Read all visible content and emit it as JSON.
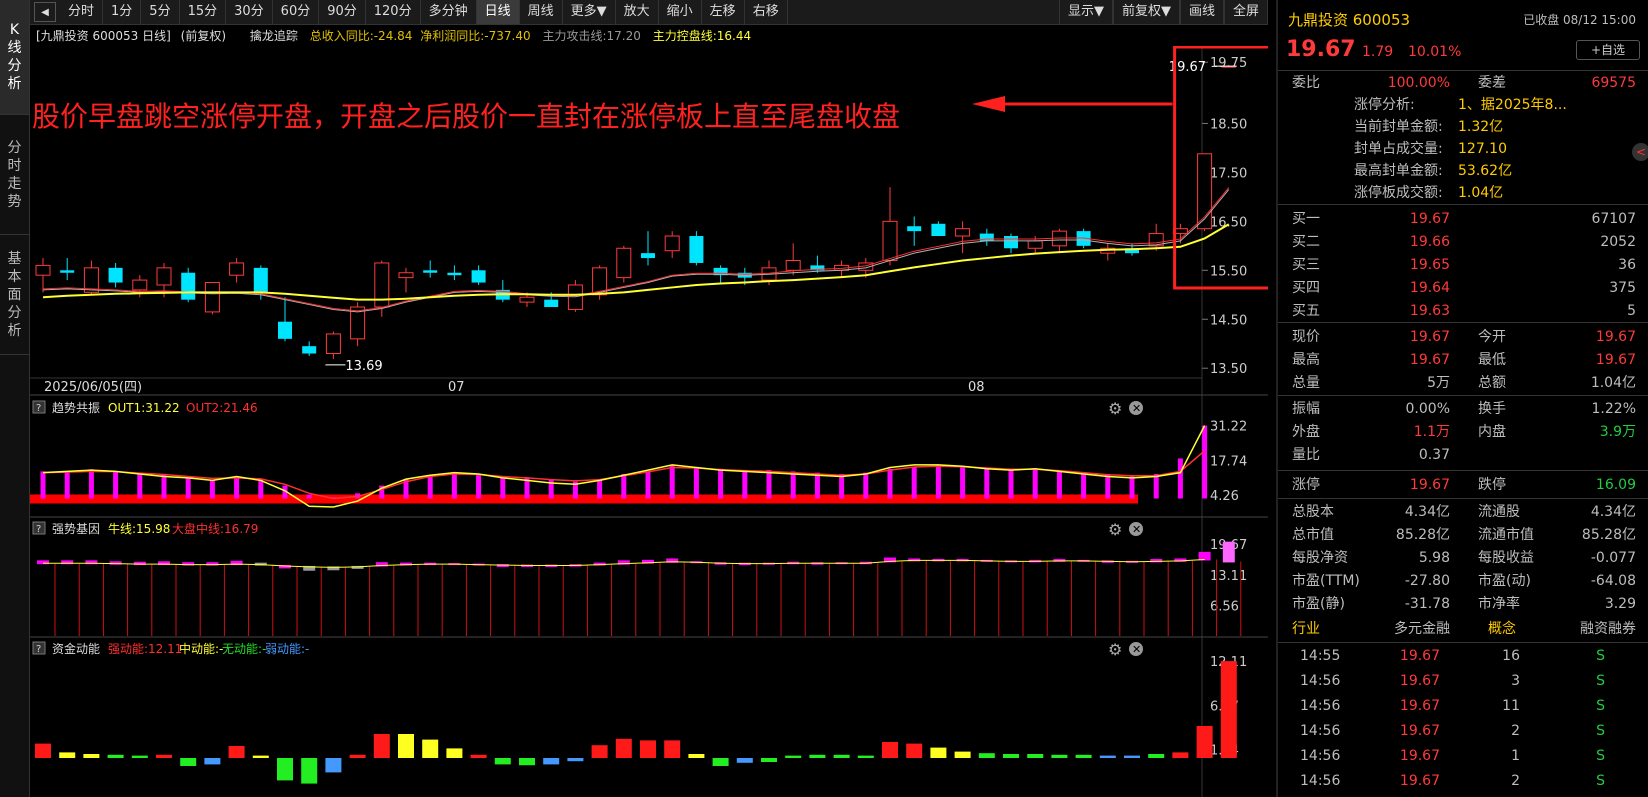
{
  "left_tabs": [
    "K线分析",
    "分时走势",
    "基本面分析"
  ],
  "toolbar": {
    "back_icon": "back-icon",
    "periods": [
      "分时",
      "1分",
      "5分",
      "15分",
      "30分",
      "60分",
      "90分",
      "120分",
      "多分钟",
      "日线",
      "周线",
      "更多▼"
    ],
    "active_period": "日线",
    "tools": [
      "放大",
      "缩小",
      "左移",
      "右移"
    ],
    "right": [
      "显示▼",
      "前复权▼",
      "画线",
      "全屏"
    ]
  },
  "chart_title": {
    "stock": "[九鼎投资 600053 日线]",
    "fq": "(前复权)",
    "indicator": "擒龙追踪",
    "revenue": "总收入同比:-24.84",
    "profit": "净利润同比:-737.40",
    "attack": "主力攻击线:17.20",
    "control": "主力控盘线:16.44"
  },
  "price_axis": [
    "19.75",
    "18.50",
    "17.50",
    "16.50",
    "15.50",
    "14.50",
    "13.50"
  ],
  "date_axis": [
    "2025/06/05(四)",
    "07",
    "08"
  ],
  "high_label": "19.67",
  "low_label": "13.69",
  "annotation": "股价早盘跳空涨停开盘，开盘之后股价一直封在涨停板上直至尾盘收盘",
  "chart_data": [
    {
      "type": "candlestick",
      "ylim": [
        13.3,
        20.0
      ],
      "ohlc": [
        [
          15.4,
          15.75,
          15.05,
          15.6
        ],
        [
          15.5,
          15.75,
          15.3,
          15.45
        ],
        [
          15.05,
          15.7,
          15.0,
          15.55
        ],
        [
          15.55,
          15.65,
          15.15,
          15.25
        ],
        [
          15.1,
          15.4,
          14.95,
          15.3
        ],
        [
          15.2,
          15.65,
          14.95,
          15.55
        ],
        [
          15.45,
          15.55,
          14.85,
          14.9
        ],
        [
          14.65,
          15.25,
          14.6,
          15.25
        ],
        [
          15.4,
          15.75,
          15.25,
          15.65
        ],
        [
          15.55,
          15.6,
          14.9,
          15.05
        ],
        [
          14.45,
          14.95,
          14.05,
          14.1
        ],
        [
          13.95,
          14.05,
          13.75,
          13.8
        ],
        [
          13.8,
          14.25,
          13.69,
          14.2
        ],
        [
          14.1,
          14.85,
          13.95,
          14.75
        ],
        [
          14.75,
          15.7,
          14.55,
          15.65
        ],
        [
          15.35,
          15.55,
          15.05,
          15.45
        ],
        [
          15.5,
          15.7,
          15.35,
          15.45
        ],
        [
          15.45,
          15.6,
          15.3,
          15.4
        ],
        [
          15.5,
          15.6,
          15.2,
          15.25
        ],
        [
          15.1,
          15.3,
          14.85,
          14.9
        ],
        [
          14.85,
          15.05,
          14.75,
          14.95
        ],
        [
          14.9,
          15.05,
          14.75,
          14.75
        ],
        [
          14.7,
          15.3,
          14.65,
          15.2
        ],
        [
          15.0,
          15.6,
          14.9,
          15.55
        ],
        [
          15.35,
          16.0,
          15.25,
          15.95
        ],
        [
          15.85,
          16.3,
          15.6,
          15.75
        ],
        [
          15.9,
          16.3,
          15.75,
          16.2
        ],
        [
          16.2,
          16.3,
          15.6,
          15.65
        ],
        [
          15.55,
          15.6,
          15.25,
          15.4
        ],
        [
          15.45,
          15.55,
          15.2,
          15.35
        ],
        [
          15.3,
          15.7,
          15.2,
          15.55
        ],
        [
          15.5,
          16.05,
          15.4,
          15.7
        ],
        [
          15.6,
          15.8,
          15.45,
          15.5
        ],
        [
          15.5,
          15.7,
          15.35,
          15.6
        ],
        [
          15.5,
          15.75,
          15.35,
          15.65
        ],
        [
          15.7,
          17.2,
          15.6,
          16.5
        ],
        [
          16.4,
          16.6,
          16.0,
          16.3
        ],
        [
          16.45,
          16.5,
          16.2,
          16.2
        ],
        [
          16.2,
          16.5,
          15.85,
          16.35
        ],
        [
          16.25,
          16.35,
          16.0,
          16.1
        ],
        [
          16.2,
          16.25,
          15.85,
          15.95
        ],
        [
          15.95,
          16.2,
          15.85,
          16.1
        ],
        [
          16.0,
          16.35,
          15.85,
          16.3
        ],
        [
          16.3,
          16.35,
          15.95,
          16.0
        ],
        [
          15.85,
          16.05,
          15.7,
          15.95
        ],
        [
          15.95,
          16.05,
          15.8,
          15.85
        ],
        [
          16.0,
          16.45,
          15.9,
          16.25
        ],
        [
          16.25,
          16.45,
          16.05,
          16.35
        ],
        [
          16.35,
          17.88,
          16.3,
          17.88
        ],
        [
          19.67,
          19.67,
          19.67,
          19.67
        ]
      ],
      "ma_white": [
        15.1,
        15.12,
        15.1,
        15.08,
        15.05,
        15.06,
        15.04,
        15.02,
        15.03,
        15.0,
        14.9,
        14.8,
        14.7,
        14.65,
        14.72,
        14.85,
        14.95,
        15.05,
        15.07,
        15.05,
        15.0,
        14.97,
        14.96,
        15.05,
        15.15,
        15.25,
        15.38,
        15.42,
        15.42,
        15.4,
        15.42,
        15.45,
        15.48,
        15.5,
        15.55,
        15.7,
        15.85,
        15.95,
        16.05,
        16.1,
        16.1,
        16.1,
        16.12,
        16.12,
        16.05,
        16.0,
        16.02,
        16.1,
        16.55,
        17.15
      ],
      "ma_yellow": [
        14.95,
        14.98,
        15.0,
        15.02,
        15.03,
        15.04,
        15.05,
        15.05,
        15.05,
        15.05,
        15.02,
        14.98,
        14.94,
        14.9,
        14.9,
        14.92,
        14.95,
        14.98,
        15.0,
        15.01,
        15.01,
        15.0,
        15.0,
        15.02,
        15.05,
        15.1,
        15.15,
        15.2,
        15.23,
        15.25,
        15.28,
        15.3,
        15.33,
        15.36,
        15.4,
        15.48,
        15.56,
        15.63,
        15.7,
        15.75,
        15.8,
        15.84,
        15.87,
        15.9,
        15.92,
        15.93,
        15.95,
        15.98,
        16.15,
        16.44
      ]
    },
    {
      "type": "bar-line",
      "name": "趋势共振",
      "label1": "OUT1:31.22",
      "label2": "OUT2:21.46",
      "yticks": [
        "31.22",
        "17.74",
        "4.26"
      ],
      "ylim": [
        -3,
        33
      ],
      "bars": [
        13.5,
        13.5,
        14.3,
        13.5,
        12.5,
        12.5,
        10.8,
        10.2,
        11.4,
        10.5,
        8.0,
        4.5,
        3.5,
        5.0,
        8.0,
        10.5,
        12.0,
        13.0,
        12.5,
        11.0,
        11.2,
        10.5,
        9.5,
        10.5,
        12.5,
        13.5,
        16.0,
        15.0,
        14.5,
        14.0,
        14.0,
        13.5,
        13.0,
        12.5,
        13.0,
        14.5,
        15.0,
        15.5,
        15.0,
        14.5,
        14.0,
        14.5,
        14.0,
        13.0,
        12.5,
        12.0,
        12.5,
        18.5,
        31.22
      ],
      "out1": [
        13.0,
        13.5,
        14.0,
        13.5,
        12.5,
        11.5,
        11.0,
        10.0,
        11.5,
        10.0,
        6.0,
        0.0,
        -0.3,
        2.0,
        7.0,
        10.5,
        12.0,
        13.0,
        12.5,
        11.0,
        10.0,
        9.0,
        8.5,
        10.0,
        12.0,
        14.0,
        16.0,
        15.0,
        14.0,
        13.5,
        13.0,
        12.5,
        12.0,
        11.5,
        12.5,
        15.0,
        16.0,
        16.0,
        15.5,
        14.5,
        14.0,
        14.5,
        13.5,
        12.5,
        11.5,
        11.0,
        11.5,
        13.0,
        31.22
      ],
      "out2": [
        13.0,
        13.2,
        13.5,
        13.4,
        12.8,
        12.3,
        11.5,
        10.8,
        11.0,
        10.6,
        8.5,
        5.0,
        3.0,
        3.8,
        6.5,
        9.5,
        11.5,
        12.5,
        12.3,
        11.5,
        11.0,
        10.3,
        9.8,
        10.3,
        11.8,
        13.3,
        15.0,
        14.8,
        14.2,
        13.8,
        13.5,
        13.0,
        12.5,
        12.0,
        12.5,
        14.0,
        15.2,
        15.5,
        15.3,
        14.8,
        14.3,
        14.3,
        13.8,
        13.0,
        12.2,
        11.8,
        11.8,
        13.5,
        21.46
      ],
      "baseline": 3
    },
    {
      "type": "bar-line",
      "name": "强势基因",
      "label1": "牛线:15.98",
      "label2": "大盘中线:16.79",
      "yticks": [
        "19.67",
        "13.11",
        "6.56"
      ],
      "ylim": [
        0,
        21
      ],
      "bars": [
        16.0,
        16.0,
        16.0,
        15.8,
        15.7,
        15.8,
        15.6,
        15.6,
        15.9,
        15.5,
        14.7,
        14.2,
        14.3,
        14.6,
        15.6,
        15.5,
        15.5,
        15.4,
        15.3,
        15.0,
        15.0,
        15.0,
        15.2,
        15.5,
        16.0,
        16.1,
        16.4,
        15.8,
        15.5,
        15.4,
        15.5,
        15.7,
        15.5,
        15.6,
        15.7,
        16.6,
        16.4,
        16.3,
        16.3,
        16.1,
        16.0,
        16.1,
        16.3,
        16.1,
        15.9,
        15.9,
        16.3,
        16.4,
        17.8,
        20.0
      ],
      "line": [
        15.6,
        15.6,
        15.6,
        15.5,
        15.4,
        15.4,
        15.3,
        15.3,
        15.4,
        15.3,
        15.0,
        14.8,
        14.7,
        14.8,
        15.1,
        15.3,
        15.4,
        15.4,
        15.3,
        15.2,
        15.1,
        15.1,
        15.1,
        15.3,
        15.5,
        15.7,
        15.9,
        15.8,
        15.6,
        15.5,
        15.5,
        15.6,
        15.6,
        15.6,
        15.6,
        16.0,
        16.2,
        16.2,
        16.2,
        16.1,
        16.0,
        16.0,
        16.1,
        16.1,
        16.0,
        15.9,
        16.0,
        16.1,
        16.4,
        15.98
      ]
    },
    {
      "type": "bar",
      "name": "资金动能",
      "label1": "强动能:12.11",
      "label2": "中动能:-",
      "label3": "无动能:-",
      "label4": "弱动能:-",
      "yticks": [
        "12.11",
        "6.57",
        "1.04"
      ],
      "ylim": [
        -4.5,
        12.5
      ],
      "values": [
        1.8,
        0.7,
        0.5,
        0.4,
        0.3,
        0.4,
        -1.0,
        -0.8,
        1.5,
        0.3,
        -2.8,
        -3.2,
        -1.8,
        0.4,
        3.0,
        3.0,
        2.3,
        1.2,
        0.4,
        -0.8,
        -0.9,
        -0.8,
        -0.4,
        1.6,
        2.4,
        2.2,
        2.2,
        0.5,
        -1.0,
        -0.6,
        -0.5,
        0.3,
        0.4,
        0.4,
        0.3,
        2.0,
        1.8,
        1.3,
        0.8,
        0.6,
        0.5,
        0.5,
        0.4,
        0.4,
        0.3,
        0.3,
        0.5,
        0.7,
        4.0,
        12.11
      ],
      "colors": [
        "r",
        "y",
        "y",
        "g",
        "g",
        "r",
        "g",
        "b",
        "r",
        "y",
        "g",
        "g",
        "b",
        "r",
        "r",
        "y",
        "y",
        "y",
        "r",
        "g",
        "g",
        "b",
        "b",
        "r",
        "r",
        "r",
        "r",
        "y",
        "g",
        "b",
        "g",
        "g",
        "g",
        "g",
        "g",
        "r",
        "r",
        "y",
        "y",
        "g",
        "g",
        "g",
        "g",
        "g",
        "b",
        "b",
        "g",
        "r",
        "r",
        "r"
      ]
    }
  ],
  "right_panel": {
    "name": "九鼎投资 600053",
    "status": "已收盘 08/12 15:00",
    "price": "19.67",
    "change": "1.79",
    "pct": "10.01%",
    "fav": "+自选",
    "weibi_label": "委比",
    "weibi": "100.00%",
    "weicha_label": "委差",
    "weicha": "69575",
    "zt_lines": [
      {
        "l": "涨停分析:",
        "v": "1、据2025年8..."
      },
      {
        "l": "当前封单金额:",
        "v": "1.32亿"
      },
      {
        "l": "封单占成交量:",
        "v": "127.10"
      },
      {
        "l": "最高封单金额:",
        "v": "53.62亿"
      },
      {
        "l": "涨停板成交额:",
        "v": "1.04亿"
      }
    ],
    "buys": [
      {
        "l": "买一",
        "p": "19.67",
        "v": "67107"
      },
      {
        "l": "买二",
        "p": "19.66",
        "v": "2052"
      },
      {
        "l": "买三",
        "p": "19.65",
        "v": "36"
      },
      {
        "l": "买四",
        "p": "19.64",
        "v": "375"
      },
      {
        "l": "买五",
        "p": "19.63",
        "v": "5"
      }
    ],
    "quote": [
      {
        "l1": "现价",
        "v1": "19.67",
        "c1": "red",
        "l2": "今开",
        "v2": "19.67",
        "c2": "red"
      },
      {
        "l1": "最高",
        "v1": "19.67",
        "c1": "red",
        "l2": "最低",
        "v2": "19.67",
        "c2": "red"
      },
      {
        "l1": "总量",
        "v1": "5万",
        "c1": "gray",
        "l2": "总额",
        "v2": "1.04亿",
        "c2": "gray"
      }
    ],
    "quote2": [
      {
        "l1": "振幅",
        "v1": "0.00%",
        "c1": "gray",
        "l2": "换手",
        "v2": "1.22%",
        "c2": "gray"
      },
      {
        "l1": "外盘",
        "v1": "1.1万",
        "c1": "red",
        "l2": "内盘",
        "v2": "3.9万",
        "c2": "green"
      },
      {
        "l1": "量比",
        "v1": "0.37",
        "c1": "gray",
        "l2": "",
        "v2": "",
        "c2": "gray"
      }
    ],
    "limit": {
      "l1": "涨停",
      "v1": "19.67",
      "l2": "跌停",
      "v2": "16.09"
    },
    "fund": [
      {
        "l1": "总股本",
        "v1": "4.34亿",
        "l2": "流通股",
        "v2": "4.34亿"
      },
      {
        "l1": "总市值",
        "v1": "85.28亿",
        "l2": "流通市值",
        "v2": "85.28亿"
      },
      {
        "l1": "每股净资",
        "v1": "5.98",
        "l2": "每股收益",
        "v2": "-0.077"
      },
      {
        "l1": "市盈(TTM)",
        "v1": "-27.80",
        "l2": "市盈(动)",
        "v2": "-64.08"
      },
      {
        "l1": "市盈(静)",
        "v1": "-31.78",
        "l2": "市净率",
        "v2": "3.29"
      }
    ],
    "industry": {
      "l1": "行业",
      "v1": "多元金融",
      "l2": "概念",
      "v2": "融资融券"
    },
    "ticks": [
      {
        "t": "14:55",
        "p": "19.67",
        "v": "16",
        "f": "S"
      },
      {
        "t": "14:56",
        "p": "19.67",
        "v": "3",
        "f": "S"
      },
      {
        "t": "14:56",
        "p": "19.67",
        "v": "11",
        "f": "S"
      },
      {
        "t": "14:56",
        "p": "19.67",
        "v": "2",
        "f": "S"
      },
      {
        "t": "14:56",
        "p": "19.67",
        "v": "1",
        "f": "S"
      },
      {
        "t": "14:56",
        "p": "19.67",
        "v": "2",
        "f": "S"
      }
    ]
  },
  "colors": {
    "up": "#ff3b3b",
    "down": "#00e5ff",
    "ma_yellow": "#ffff33",
    "ma_white": "#b0b0b0",
    "magenta": "#ff00ff",
    "annot": "#ff2020"
  }
}
